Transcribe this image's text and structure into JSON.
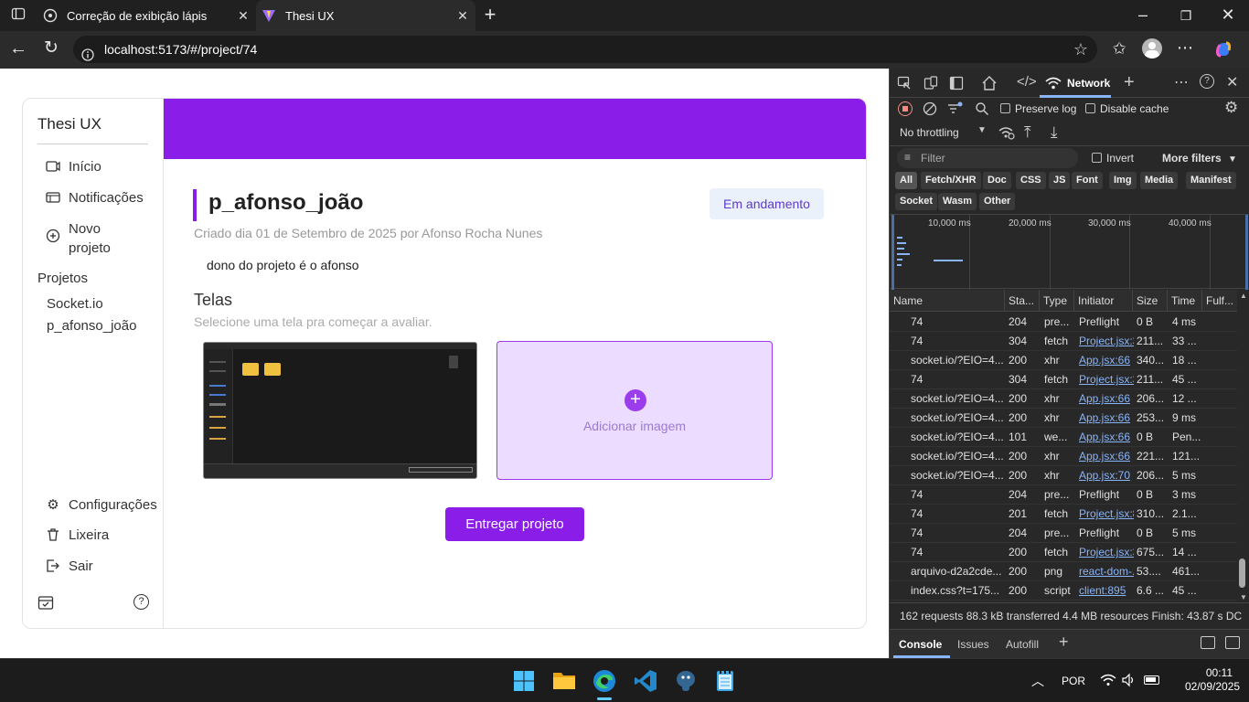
{
  "browser": {
    "tabs": [
      {
        "title": "Correção de exibição lápis",
        "active": false
      },
      {
        "title": "Thesi UX",
        "active": true
      }
    ],
    "url": "localhost:5173/#/project/74"
  },
  "app": {
    "brand": "Thesi UX",
    "nav": [
      {
        "label": "Início",
        "icon": "camera-icon"
      },
      {
        "label": "Notificações",
        "icon": "image-icon"
      },
      {
        "label": "Novo projeto",
        "icon": "plus-circle-icon"
      }
    ],
    "projects_heading": "Projetos",
    "projects": [
      "Socket.io",
      "p_afonso_joão"
    ],
    "bottom_nav": [
      {
        "label": "Configurações",
        "icon": "gear-icon"
      },
      {
        "label": "Lixeira",
        "icon": "trash-icon"
      },
      {
        "label": "Sair",
        "icon": "logout-icon"
      }
    ]
  },
  "project": {
    "title": "p_afonso_joão",
    "status": "Em andamento",
    "created": "Criado dia 01 de Setembro de 2025 por Afonso Rocha Nunes",
    "description": "dono do projeto é o afonso",
    "screens_heading": "Telas",
    "screens_sub": "Selecione uma tela pra começar a avaliar.",
    "add_image": "Adicionar imagem",
    "submit": "Entregar projeto"
  },
  "devtools": {
    "active_tab": "Network",
    "preserve_log": "Preserve log",
    "disable_cache": "Disable cache",
    "throttling": "No throttling",
    "filter_placeholder": "Filter",
    "invert": "Invert",
    "more_filters": "More filters",
    "type_filters": [
      "All",
      "Fetch/XHR",
      "Doc",
      "CSS",
      "JS",
      "Font",
      "Img",
      "Media",
      "Manifest",
      "Socket",
      "Wasm",
      "Other"
    ],
    "timeline_ticks": [
      "10,000 ms",
      "20,000 ms",
      "30,000 ms",
      "40,000 ms"
    ],
    "columns": [
      "Name",
      "Sta...",
      "Type",
      "Initiator",
      "Size",
      "Time",
      "Fulf..."
    ],
    "rows": [
      {
        "name": "74",
        "status": "204",
        "type": "pre...",
        "initiator": "Preflight",
        "size": "0 B",
        "time": "4 ms"
      },
      {
        "name": "74",
        "status": "304",
        "type": "fetch",
        "initiator": "Project.jsx:3",
        "size": "211...",
        "time": "33 ..."
      },
      {
        "name": "socket.io/?EIO=4...",
        "status": "200",
        "type": "xhr",
        "initiator": "App.jsx:66",
        "size": "340...",
        "time": "18 ..."
      },
      {
        "name": "74",
        "status": "304",
        "type": "fetch",
        "initiator": "Project.jsx:3",
        "size": "211...",
        "time": "45 ..."
      },
      {
        "name": "socket.io/?EIO=4...",
        "status": "200",
        "type": "xhr",
        "initiator": "App.jsx:66",
        "size": "206...",
        "time": "12 ..."
      },
      {
        "name": "socket.io/?EIO=4...",
        "status": "200",
        "type": "xhr",
        "initiator": "App.jsx:66",
        "size": "253...",
        "time": "9 ms"
      },
      {
        "name": "socket.io/?EIO=4...",
        "status": "101",
        "type": "we...",
        "initiator": "App.jsx:66",
        "size": "0 B",
        "time": "Pen..."
      },
      {
        "name": "socket.io/?EIO=4...",
        "status": "200",
        "type": "xhr",
        "initiator": "App.jsx:66",
        "size": "221...",
        "time": "121..."
      },
      {
        "name": "socket.io/?EIO=4...",
        "status": "200",
        "type": "xhr",
        "initiator": "App.jsx:70",
        "size": "206...",
        "time": "5 ms"
      },
      {
        "name": "74",
        "status": "204",
        "type": "pre...",
        "initiator": "Preflight",
        "size": "0 B",
        "time": "3 ms"
      },
      {
        "name": "74",
        "status": "201",
        "type": "fetch",
        "initiator": "Project.jsx:8",
        "size": "310...",
        "time": "2.1..."
      },
      {
        "name": "74",
        "status": "204",
        "type": "pre...",
        "initiator": "Preflight",
        "size": "0 B",
        "time": "5 ms"
      },
      {
        "name": "74",
        "status": "200",
        "type": "fetch",
        "initiator": "Project.jsx:3",
        "size": "675...",
        "time": "14 ..."
      },
      {
        "name": "arquivo-d2a2cde...",
        "status": "200",
        "type": "png",
        "initiator": "react-dom-...",
        "size": "53....",
        "time": "461..."
      },
      {
        "name": "index.css?t=175...",
        "status": "200",
        "type": "script",
        "initiator": "client:895",
        "size": "6.6 ...",
        "time": "45 ..."
      }
    ],
    "summary": "162 requests   88.3 kB transferred   4.4 MB resources   Finish: 43.87 s   DC",
    "drawer_tabs": [
      "Console",
      "Issues",
      "Autofill"
    ]
  },
  "taskbar": {
    "language": "POR",
    "time": "00:11",
    "date": "02/09/2025"
  }
}
